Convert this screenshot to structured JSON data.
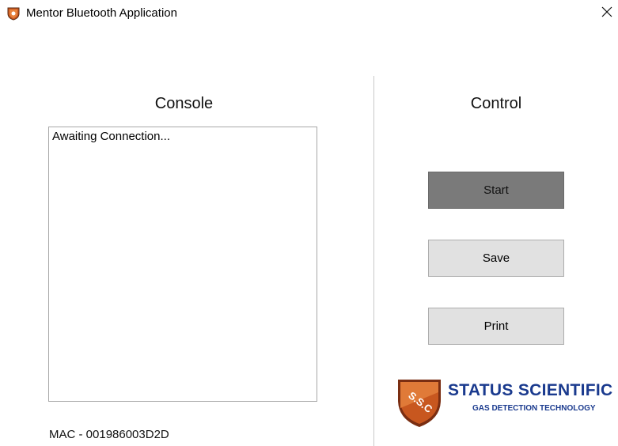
{
  "window": {
    "title": "Mentor Bluetooth Application"
  },
  "console": {
    "heading": "Console",
    "text": "Awaiting Connection...",
    "mac_label": "MAC - 001986003D2D"
  },
  "control": {
    "heading": "Control",
    "start_label": "Start",
    "save_label": "Save",
    "print_label": "Print"
  },
  "logo": {
    "shield_text": "S.S.C",
    "name": "STATUS SCIENTIFIC",
    "tagline": "GAS DETECTION TECHNOLOGY"
  },
  "colors": {
    "brand_blue": "#1a3a8e",
    "shield_orange": "#c8571f",
    "start_button_bg": "#7a7a7a",
    "button_bg": "#e1e1e1"
  },
  "icons": {
    "app": "shield-app-icon",
    "close": "close-icon"
  }
}
